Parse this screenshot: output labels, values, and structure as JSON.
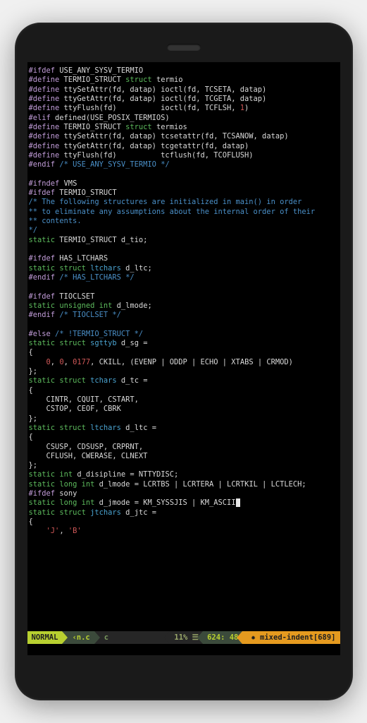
{
  "code": {
    "lines": [
      {
        "segs": [
          {
            "cls": "pp",
            "t": "#ifdef"
          },
          {
            "cls": "txt",
            "t": " USE_ANY_SYSV_TERMIO"
          }
        ]
      },
      {
        "segs": [
          {
            "cls": "pp",
            "t": "#define"
          },
          {
            "cls": "txt",
            "t": " TERMIO_STRUCT "
          },
          {
            "cls": "kw",
            "t": "struct"
          },
          {
            "cls": "txt",
            "t": " termio"
          }
        ]
      },
      {
        "segs": [
          {
            "cls": "pp",
            "t": "#define"
          },
          {
            "cls": "txt",
            "t": " ttySetAttr(fd, datap) ioctl(fd, TCSETA, datap)"
          }
        ]
      },
      {
        "segs": [
          {
            "cls": "pp",
            "t": "#define"
          },
          {
            "cls": "txt",
            "t": " ttyGetAttr(fd, datap) ioctl(fd, TCGETA, datap)"
          }
        ]
      },
      {
        "segs": [
          {
            "cls": "pp",
            "t": "#define"
          },
          {
            "cls": "txt",
            "t": " ttyFlush(fd)          ioctl(fd, TCFLSH, "
          },
          {
            "cls": "num",
            "t": "1"
          },
          {
            "cls": "txt",
            "t": ")"
          }
        ]
      },
      {
        "segs": [
          {
            "cls": "pp",
            "t": "#elif"
          },
          {
            "cls": "txt",
            "t": " defined(USE_POSIX_TERMIOS)"
          }
        ]
      },
      {
        "segs": [
          {
            "cls": "pp",
            "t": "#define"
          },
          {
            "cls": "txt",
            "t": " TERMIO_STRUCT "
          },
          {
            "cls": "kw",
            "t": "struct"
          },
          {
            "cls": "txt",
            "t": " termios"
          }
        ]
      },
      {
        "segs": [
          {
            "cls": "pp",
            "t": "#define"
          },
          {
            "cls": "txt",
            "t": " ttySetAttr(fd, datap) tcsetattr(fd, TCSANOW, datap)"
          }
        ]
      },
      {
        "segs": [
          {
            "cls": "pp",
            "t": "#define"
          },
          {
            "cls": "txt",
            "t": " ttyGetAttr(fd, datap) tcgetattr(fd, datap)"
          }
        ]
      },
      {
        "segs": [
          {
            "cls": "pp",
            "t": "#define"
          },
          {
            "cls": "txt",
            "t": " ttyFlush(fd)          tcflush(fd, TCOFLUSH)"
          }
        ]
      },
      {
        "segs": [
          {
            "cls": "pp",
            "t": "#endif"
          },
          {
            "cls": "txt",
            "t": " "
          },
          {
            "cls": "cm",
            "t": "/* USE_ANY_SYSV_TERMIO */"
          }
        ]
      },
      {
        "segs": [
          {
            "cls": "txt",
            "t": " "
          }
        ]
      },
      {
        "segs": [
          {
            "cls": "pp",
            "t": "#ifndef"
          },
          {
            "cls": "txt",
            "t": " VMS"
          }
        ]
      },
      {
        "segs": [
          {
            "cls": "pp",
            "t": "#ifdef"
          },
          {
            "cls": "txt",
            "t": " TERMIO_STRUCT"
          }
        ]
      },
      {
        "segs": [
          {
            "cls": "cm",
            "t": "/* The following structures are initialized in main() in order"
          }
        ]
      },
      {
        "segs": [
          {
            "cls": "cm",
            "t": "** to eliminate any assumptions about the internal order of their"
          }
        ]
      },
      {
        "segs": [
          {
            "cls": "cm",
            "t": "** contents."
          }
        ]
      },
      {
        "segs": [
          {
            "cls": "cm",
            "t": "*/"
          }
        ]
      },
      {
        "segs": [
          {
            "cls": "kw",
            "t": "static"
          },
          {
            "cls": "txt",
            "t": " TERMIO_STRUCT d_tio;"
          }
        ]
      },
      {
        "segs": [
          {
            "cls": "txt",
            "t": " "
          }
        ]
      },
      {
        "segs": [
          {
            "cls": "pp",
            "t": "#ifdef"
          },
          {
            "cls": "txt",
            "t": " HAS_LTCHARS"
          }
        ]
      },
      {
        "segs": [
          {
            "cls": "kw",
            "t": "static"
          },
          {
            "cls": "txt",
            "t": " "
          },
          {
            "cls": "kw",
            "t": "struct"
          },
          {
            "cls": "txt",
            "t": " "
          },
          {
            "cls": "ty",
            "t": "ltchars"
          },
          {
            "cls": "txt",
            "t": " d_ltc;"
          }
        ]
      },
      {
        "segs": [
          {
            "cls": "pp",
            "t": "#endif"
          },
          {
            "cls": "txt",
            "t": " "
          },
          {
            "cls": "cm",
            "t": "/* HAS_LTCHARS */"
          }
        ]
      },
      {
        "segs": [
          {
            "cls": "txt",
            "t": " "
          }
        ]
      },
      {
        "segs": [
          {
            "cls": "pp",
            "t": "#ifdef"
          },
          {
            "cls": "txt",
            "t": " TIOCLSET"
          }
        ]
      },
      {
        "segs": [
          {
            "cls": "kw",
            "t": "static"
          },
          {
            "cls": "txt",
            "t": " "
          },
          {
            "cls": "kw",
            "t": "unsigned"
          },
          {
            "cls": "txt",
            "t": " "
          },
          {
            "cls": "kw",
            "t": "int"
          },
          {
            "cls": "txt",
            "t": " d_lmode;"
          }
        ]
      },
      {
        "segs": [
          {
            "cls": "pp",
            "t": "#endif"
          },
          {
            "cls": "txt",
            "t": " "
          },
          {
            "cls": "cm",
            "t": "/* TIOCLSET */"
          }
        ]
      },
      {
        "segs": [
          {
            "cls": "txt",
            "t": " "
          }
        ]
      },
      {
        "segs": [
          {
            "cls": "pp",
            "t": "#else"
          },
          {
            "cls": "txt",
            "t": " "
          },
          {
            "cls": "cm",
            "t": "/* !TERMIO_STRUCT */"
          }
        ]
      },
      {
        "segs": [
          {
            "cls": "kw",
            "t": "static"
          },
          {
            "cls": "txt",
            "t": " "
          },
          {
            "cls": "kw",
            "t": "struct"
          },
          {
            "cls": "txt",
            "t": " "
          },
          {
            "cls": "ty",
            "t": "sgttyb"
          },
          {
            "cls": "txt",
            "t": " d_sg ="
          }
        ]
      },
      {
        "segs": [
          {
            "cls": "txt",
            "t": "{"
          }
        ]
      },
      {
        "segs": [
          {
            "cls": "txt",
            "t": "    "
          },
          {
            "cls": "num",
            "t": "0"
          },
          {
            "cls": "txt",
            "t": ", "
          },
          {
            "cls": "num",
            "t": "0"
          },
          {
            "cls": "txt",
            "t": ", "
          },
          {
            "cls": "num",
            "t": "0177"
          },
          {
            "cls": "txt",
            "t": ", CKILL, (EVENP | ODDP | ECHO | XTABS | CRMOD)"
          }
        ]
      },
      {
        "segs": [
          {
            "cls": "txt",
            "t": "};"
          }
        ]
      },
      {
        "segs": [
          {
            "cls": "kw",
            "t": "static"
          },
          {
            "cls": "txt",
            "t": " "
          },
          {
            "cls": "kw",
            "t": "struct"
          },
          {
            "cls": "txt",
            "t": " "
          },
          {
            "cls": "ty",
            "t": "tchars"
          },
          {
            "cls": "txt",
            "t": " d_tc ="
          }
        ]
      },
      {
        "segs": [
          {
            "cls": "txt",
            "t": "{"
          }
        ]
      },
      {
        "segs": [
          {
            "cls": "txt",
            "t": "    CINTR, CQUIT, CSTART,"
          }
        ]
      },
      {
        "segs": [
          {
            "cls": "txt",
            "t": "    CSTOP, CEOF, CBRK"
          }
        ]
      },
      {
        "segs": [
          {
            "cls": "txt",
            "t": "};"
          }
        ]
      },
      {
        "segs": [
          {
            "cls": "kw",
            "t": "static"
          },
          {
            "cls": "txt",
            "t": " "
          },
          {
            "cls": "kw",
            "t": "struct"
          },
          {
            "cls": "txt",
            "t": " "
          },
          {
            "cls": "ty",
            "t": "ltchars"
          },
          {
            "cls": "txt",
            "t": " d_ltc ="
          }
        ]
      },
      {
        "segs": [
          {
            "cls": "txt",
            "t": "{"
          }
        ]
      },
      {
        "segs": [
          {
            "cls": "txt",
            "t": "    CSUSP, CDSUSP, CRPRNT,"
          }
        ]
      },
      {
        "segs": [
          {
            "cls": "txt",
            "t": "    CFLUSH, CWERASE, CLNEXT"
          }
        ]
      },
      {
        "segs": [
          {
            "cls": "txt",
            "t": "};"
          }
        ]
      },
      {
        "segs": [
          {
            "cls": "kw",
            "t": "static"
          },
          {
            "cls": "txt",
            "t": " "
          },
          {
            "cls": "kw",
            "t": "int"
          },
          {
            "cls": "txt",
            "t": " d_disipline = NTTYDISC;"
          }
        ]
      },
      {
        "segs": [
          {
            "cls": "kw",
            "t": "static"
          },
          {
            "cls": "txt",
            "t": " "
          },
          {
            "cls": "kw",
            "t": "long"
          },
          {
            "cls": "txt",
            "t": " "
          },
          {
            "cls": "kw",
            "t": "int"
          },
          {
            "cls": "txt",
            "t": " d_lmode = LCRTBS | LCRTERA | LCRTKIL | LCTLECH;"
          }
        ]
      },
      {
        "segs": [
          {
            "cls": "pp",
            "t": "#ifdef"
          },
          {
            "cls": "txt",
            "t": " sony"
          }
        ]
      },
      {
        "segs": [
          {
            "cls": "kw",
            "t": "static"
          },
          {
            "cls": "txt",
            "t": " "
          },
          {
            "cls": "kw",
            "t": "long"
          },
          {
            "cls": "txt",
            "t": " "
          },
          {
            "cls": "kw",
            "t": "int"
          },
          {
            "cls": "txt",
            "t": " d_jmode = KM_SYSSJIS | KM_ASCII"
          },
          {
            "cls": "cur",
            "t": ";"
          }
        ]
      },
      {
        "segs": [
          {
            "cls": "kw",
            "t": "static"
          },
          {
            "cls": "txt",
            "t": " "
          },
          {
            "cls": "kw",
            "t": "struct"
          },
          {
            "cls": "txt",
            "t": " "
          },
          {
            "cls": "ty",
            "t": "jtchars"
          },
          {
            "cls": "txt",
            "t": " d_jtc ="
          }
        ]
      },
      {
        "segs": [
          {
            "cls": "txt",
            "t": "{"
          }
        ]
      },
      {
        "segs": [
          {
            "cls": "txt",
            "t": "    "
          },
          {
            "cls": "num",
            "t": "'J'"
          },
          {
            "cls": "txt",
            "t": ", "
          },
          {
            "cls": "num",
            "t": "'B'"
          }
        ]
      },
      {
        "segs": [
          {
            "cls": "txt",
            "t": " "
          }
        ]
      }
    ]
  },
  "status": {
    "mode": "NORMAL",
    "file_indicator": "‹n.c",
    "filetype": "c",
    "percent": "11%",
    "line_sym": "☰",
    "line": "624",
    "col_sep": ":",
    "col": "48",
    "warn_sym": "✹",
    "warn_text": "mixed-indent",
    "warn_loc": "[689]"
  }
}
